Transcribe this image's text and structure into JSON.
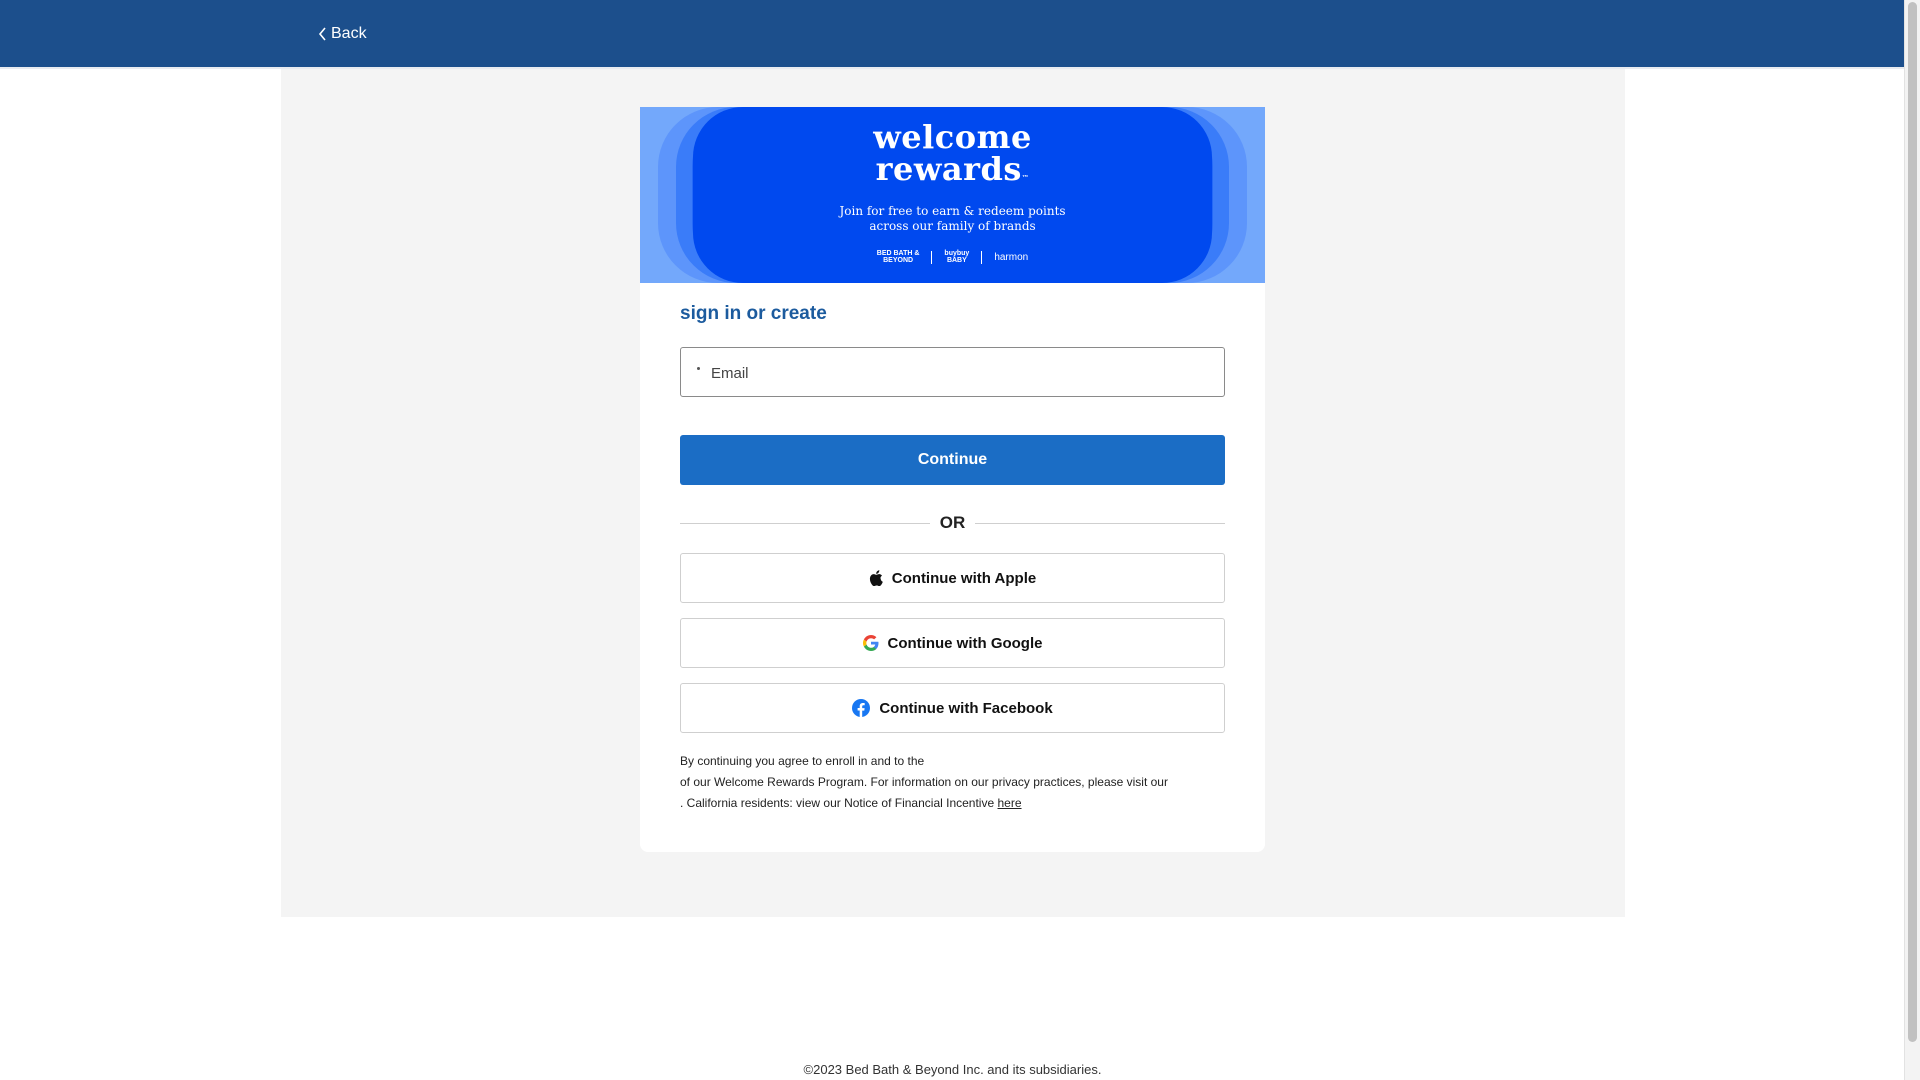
{
  "header": {
    "back_label": "Back",
    "background_color": "#1c4f8c"
  },
  "banner": {
    "title_line1": "welcome",
    "title_line2": "rewards",
    "trademark": "™",
    "subtitle_line1": "Join for free to earn & redeem points",
    "subtitle_line2": "across our family of brands",
    "brand_1_line1": "BED BATH &",
    "brand_1_line2": "BEYOND",
    "brand_2_line1": "buybuy",
    "brand_2_line2": "BABY",
    "brand_3": "harmon",
    "background_color": "#0049ef"
  },
  "form": {
    "heading": "sign in or create",
    "email_placeholder": "Email",
    "continue_label": "Continue",
    "or_label": "OR",
    "apple_label": "Continue with Apple",
    "google_label": "Continue with Google",
    "facebook_label": "Continue with Facebook",
    "primary_color": "#1b6dc5"
  },
  "legal": {
    "line1": "By continuing you agree to enroll in and to the",
    "line2": "of our Welcome Rewards Program. For information on our privacy practices, please visit our",
    "line3_prefix": ". California residents: view our Notice of Financial Incentive",
    "here_link": "here"
  },
  "footer": {
    "copyright": "©2023 Bed Bath & Beyond Inc. and its subsidiaries."
  }
}
